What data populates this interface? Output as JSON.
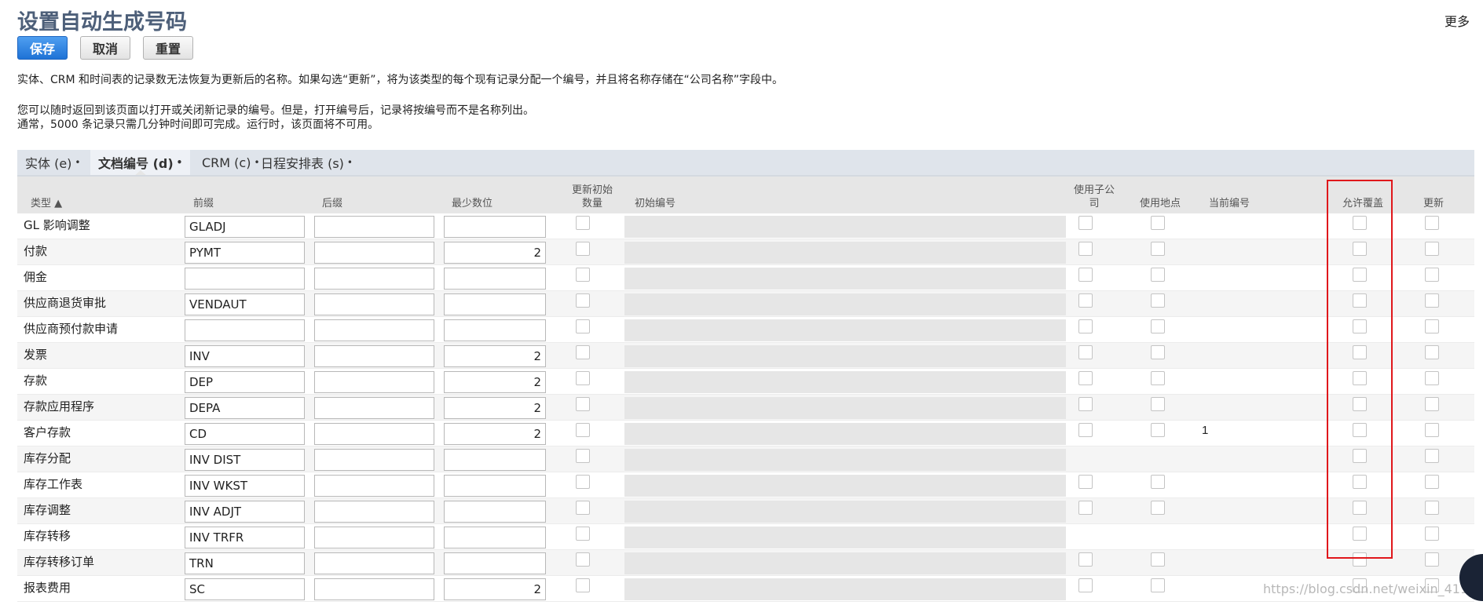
{
  "page": {
    "title": "设置自动生成号码",
    "more_link": "更多"
  },
  "toolbar": {
    "save_label": "保存",
    "cancel_label": "取消",
    "reset_label": "重置"
  },
  "description": {
    "line1": "实体、CRM 和时间表的记录数无法恢复为更新后的名称。如果勾选“更新”，将为该类型的每个现有记录分配一个编号，并且将名称存储在“公司名称”字段中。",
    "line2": "您可以随时返回到该页面以打开或关闭新记录的编号。但是，打开编号后，记录将按编号而不是名称列出。",
    "line3": "通常，5000 条记录只需几分钟时间即可完成。运行时，该页面将不可用。"
  },
  "tabs": [
    {
      "label": "实体 (e)",
      "active": false
    },
    {
      "label": "文档编号 (d)",
      "active": true
    },
    {
      "label": "CRM (c)",
      "active": false
    },
    {
      "label": "日程安排表 (s)",
      "active": false
    }
  ],
  "tab_separator": "•",
  "columns": {
    "type": "类型 ▲",
    "prefix": "前缀",
    "suffix": "后缀",
    "min_digits": "最少数位",
    "update_initial_line1": "更新初始",
    "update_initial_line2": "数量",
    "initial_number": "初始编号",
    "use_subsidiary_line1": "使用子公",
    "use_subsidiary_line2": "司",
    "use_location": "使用地点",
    "current_number": "当前编号",
    "allow_override": "允许覆盖",
    "update": "更新"
  },
  "rows": [
    {
      "type": "GL 影响调整",
      "prefix": "GLADJ",
      "suffix": "",
      "min_digits": "",
      "current": "",
      "has_sub_loc": true
    },
    {
      "type": "付款",
      "prefix": "PYMT",
      "suffix": "",
      "min_digits": "2",
      "current": "",
      "has_sub_loc": true
    },
    {
      "type": "佣金",
      "prefix": "",
      "suffix": "",
      "min_digits": "",
      "current": "",
      "has_sub_loc": true
    },
    {
      "type": "供应商退货审批",
      "prefix": "VENDAUT",
      "suffix": "",
      "min_digits": "",
      "current": "",
      "has_sub_loc": true
    },
    {
      "type": "供应商预付款申请",
      "prefix": "",
      "suffix": "",
      "min_digits": "",
      "current": "",
      "has_sub_loc": true
    },
    {
      "type": "发票",
      "prefix": "INV",
      "suffix": "",
      "min_digits": "2",
      "current": "",
      "has_sub_loc": true
    },
    {
      "type": "存款",
      "prefix": "DEP",
      "suffix": "",
      "min_digits": "2",
      "current": "",
      "has_sub_loc": true
    },
    {
      "type": "存款应用程序",
      "prefix": "DEPA",
      "suffix": "",
      "min_digits": "2",
      "current": "",
      "has_sub_loc": true
    },
    {
      "type": "客户存款",
      "prefix": "CD",
      "suffix": "",
      "min_digits": "2",
      "current": "1",
      "has_sub_loc": true
    },
    {
      "type": "库存分配",
      "prefix": "INV DIST",
      "suffix": "",
      "min_digits": "",
      "current": "",
      "has_sub_loc": false
    },
    {
      "type": "库存工作表",
      "prefix": "INV WKST",
      "suffix": "",
      "min_digits": "",
      "current": "",
      "has_sub_loc": true
    },
    {
      "type": "库存调整",
      "prefix": "INV ADJT",
      "suffix": "",
      "min_digits": "",
      "current": "",
      "has_sub_loc": true
    },
    {
      "type": "库存转移",
      "prefix": "INV TRFR",
      "suffix": "",
      "min_digits": "",
      "current": "",
      "has_sub_loc": false
    },
    {
      "type": "库存转移订单",
      "prefix": "TRN",
      "suffix": "",
      "min_digits": "",
      "current": "",
      "has_sub_loc": true
    },
    {
      "type": "报表费用",
      "prefix": "SC",
      "suffix": "",
      "min_digits": "2",
      "current": "",
      "has_sub_loc": true
    }
  ],
  "watermark": "https://blog.csdn.net/weixin_41106116",
  "colors": {
    "title": "#4d5f79",
    "primary_button": "#1e72d6",
    "highlight_box": "#e0171b",
    "tab_bar": "#dfe4eb",
    "header_bg": "#e6e6e6"
  }
}
